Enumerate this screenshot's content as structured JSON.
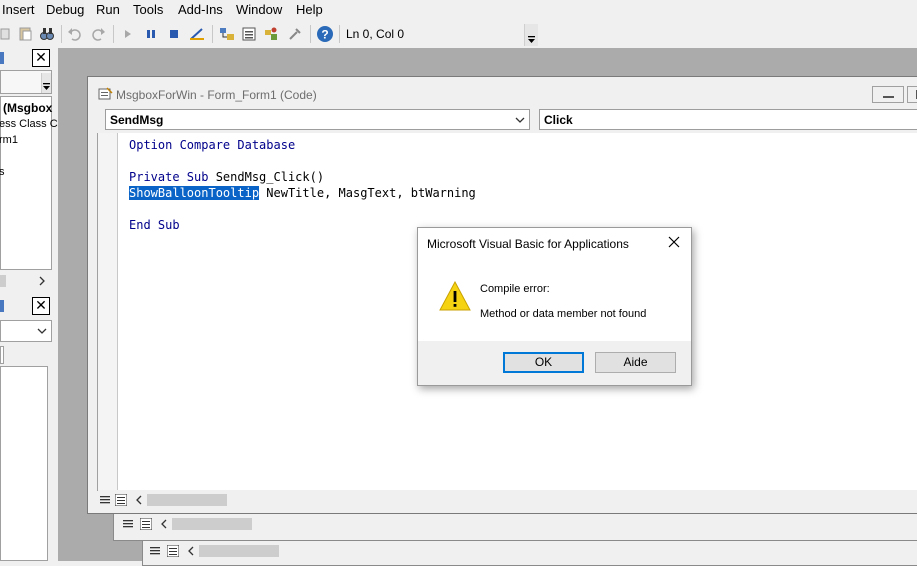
{
  "menubar": {
    "items": [
      {
        "label": "Insert"
      },
      {
        "label": "Debug"
      },
      {
        "label": "Run"
      },
      {
        "label": "Tools"
      },
      {
        "label": "Add-Ins"
      },
      {
        "label": "Window"
      },
      {
        "label": "Help"
      }
    ]
  },
  "toolbar": {
    "cursor_position": "Ln 0, Col 0"
  },
  "project_panel": {
    "items": [
      "(Msgbox",
      "ess Class C",
      "rm1",
      "s"
    ]
  },
  "code_window": {
    "title": "MsgboxForWin - Form_Form1 (Code)",
    "object_combo": "SendMsg",
    "procedure_combo": "Click",
    "lines": {
      "l1": "Option Compare Database",
      "l2_kw": "Private Sub",
      "l2_rest": " SendMsg_Click()",
      "l3_sel": "ShowBalloonTooltip",
      "l3_rest": " NewTitle, MasgText, btWarning",
      "l4": "End Sub"
    }
  },
  "dialog": {
    "title": "Microsoft Visual Basic for Applications",
    "heading": "Compile error:",
    "message": "Method or data member not found",
    "ok_label": "OK",
    "help_label": "Aide"
  }
}
